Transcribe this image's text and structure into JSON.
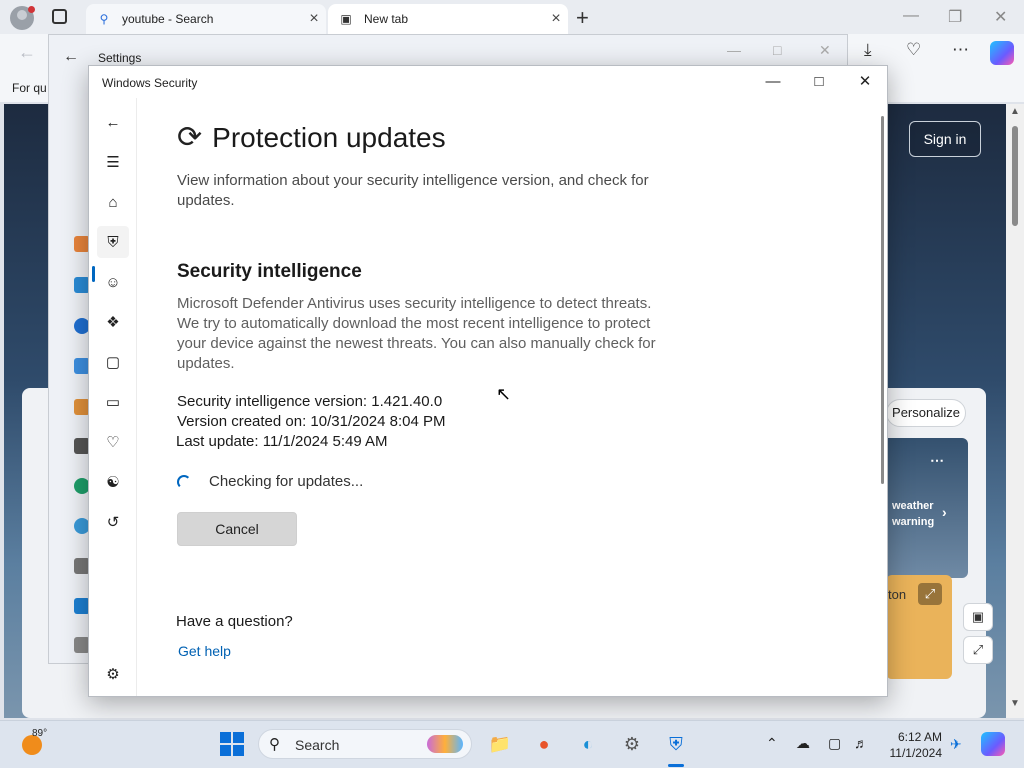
{
  "browser": {
    "tabs": [
      {
        "label": "youtube - Search",
        "icon": "search-icon"
      },
      {
        "label": "New tab",
        "icon": "newtab-icon"
      }
    ],
    "favorites_text": "For qu",
    "newtab": {
      "sign_in": "Sign in",
      "personalize": "Personalize",
      "weather_line1": "weather",
      "weather_line2": "warning",
      "image_label": "ton"
    }
  },
  "settings_window": {
    "title": "Settings"
  },
  "security_window": {
    "title": "Windows Security",
    "page_title": "Protection updates",
    "intro": "View information about your security intelligence version, and check for updates.",
    "section_title": "Security intelligence",
    "section_desc": "Microsoft Defender Antivirus uses security intelligence to detect threats. We try to automatically download the most recent intelligence to protect your device against the newest threats. You can also manually check for updates.",
    "info": {
      "version": "Security intelligence version: 1.421.40.0",
      "created": "Version created on: 10/31/2024 8:04 PM",
      "last_update": "Last update: 11/1/2024 5:49 AM"
    },
    "status": "Checking for updates...",
    "cancel_label": "Cancel",
    "question": "Have a question?",
    "help_link": "Get help",
    "nav_items": [
      "back-icon",
      "menu-icon",
      "home-icon",
      "shield-icon",
      "account-icon",
      "firewall-icon",
      "app-browser-icon",
      "device-security-icon",
      "health-icon",
      "family-icon",
      "history-icon",
      "settings-icon"
    ]
  },
  "taskbar": {
    "weather_temp": "89°",
    "search_label": "Search",
    "time": "6:12 AM",
    "date": "11/1/2024"
  },
  "colors": {
    "accent": "#0067c0",
    "link": "#0061b3",
    "taskbar": "#dde4ee"
  }
}
